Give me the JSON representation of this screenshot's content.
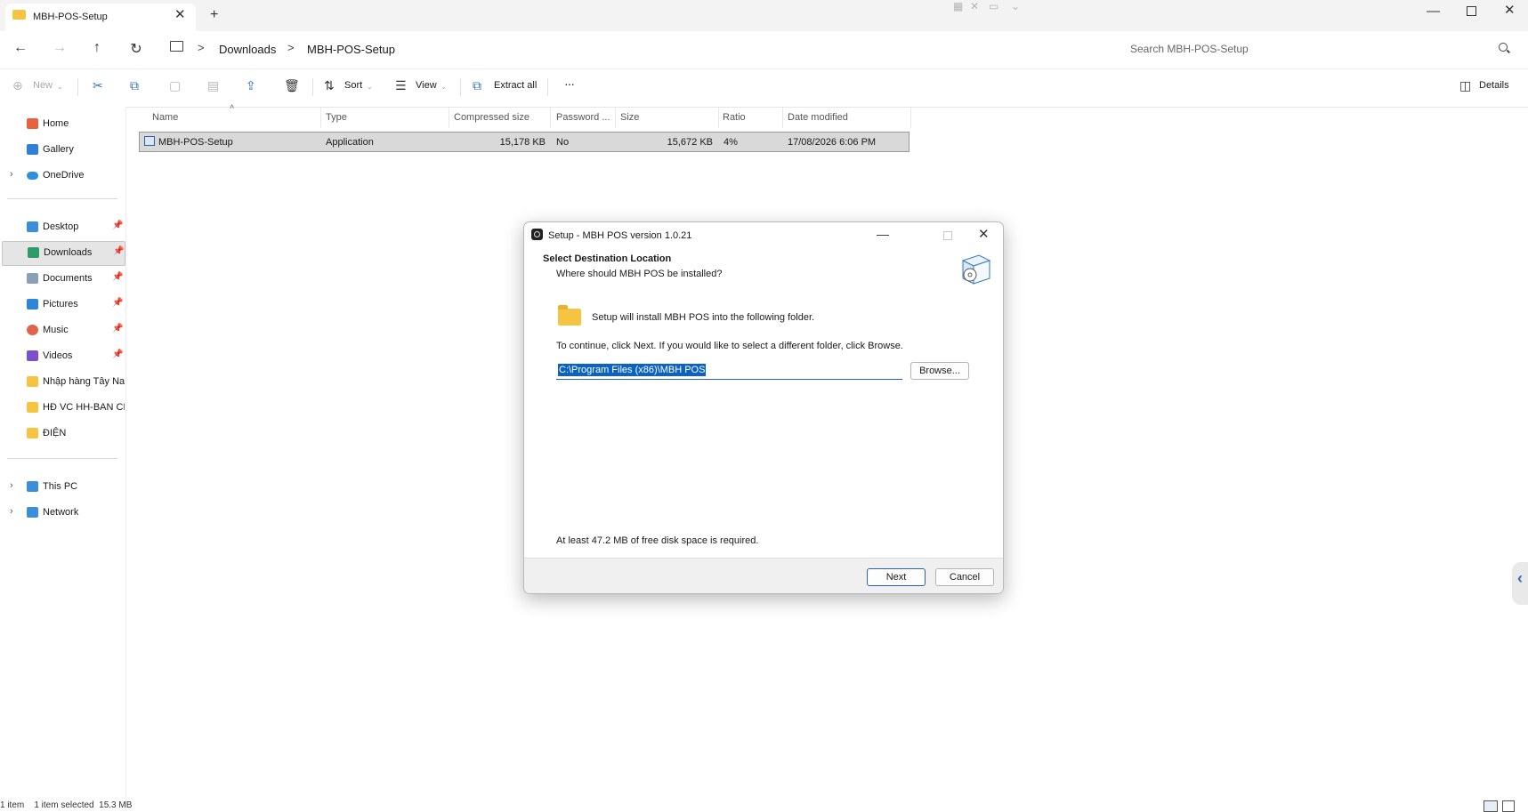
{
  "tab": {
    "title": "MBH-POS-Setup",
    "close": "✕",
    "new": "+"
  },
  "nav": {
    "back": "←",
    "forward": "→",
    "up": "↑",
    "refresh": "↻",
    "breadcrumb": [
      "Downloads",
      "MBH-POS-Setup"
    ],
    "separator": ">",
    "search_placeholder": "Search MBH-POS-Setup"
  },
  "commands": {
    "new": "New",
    "sort": "Sort",
    "view": "View",
    "extract_all": "Extract all",
    "more": "···",
    "details": "Details"
  },
  "sidebar": {
    "quick": [
      {
        "label": "Home",
        "color": "#e8623d"
      },
      {
        "label": "Gallery",
        "color": "#2f7fd6"
      },
      {
        "label": "OneDrive",
        "color": "#2f8ee0"
      }
    ],
    "pinned": [
      {
        "label": "Desktop",
        "color": "#3a8fd8"
      },
      {
        "label": "Downloads",
        "color": "#2f9a6a"
      },
      {
        "label": "Documents",
        "color": "#8aa0b8"
      },
      {
        "label": "Pictures",
        "color": "#2f86d6"
      },
      {
        "label": "Music",
        "color": "#e0644a"
      },
      {
        "label": "Videos",
        "color": "#7a52c7"
      },
      {
        "label": "Nhập hàng Tây Nar",
        "color": "#f5c542"
      },
      {
        "label": "HĐ VC HH-BAN CH",
        "color": "#f5c542"
      },
      {
        "label": "ĐIỆN",
        "color": "#f5c542"
      }
    ],
    "devices": [
      {
        "label": "This PC",
        "color": "#3a8fd8"
      },
      {
        "label": "Network",
        "color": "#3a8fd8"
      }
    ]
  },
  "table": {
    "columns": [
      "Name",
      "Type",
      "Compressed size",
      "Password ...",
      "Size",
      "Ratio",
      "Date modified"
    ],
    "rows": [
      {
        "name": "MBH-POS-Setup",
        "type": "Application",
        "compressed": "15,178 KB",
        "password": "No",
        "size": "15,672 KB",
        "ratio": "4%",
        "date": "17/08/2026 6:06 PM"
      }
    ]
  },
  "status": "1 item    1 item selected  15.3 MB",
  "dialog": {
    "title": "Setup - MBH POS version 1.0.21",
    "heading": "Select Destination Location",
    "subheading": "Where should MBH POS be installed?",
    "info": "Setup will install MBH POS into the following folder.",
    "instructions": "To continue, click Next. If you would like to select a different folder, click Browse.",
    "path": "C:\\Program Files (x86)\\MBH POS",
    "browse": "Browse...",
    "space": "At least 47.2 MB of free disk space is required.",
    "next": "Next",
    "cancel": "Cancel",
    "min": "—",
    "close": "✕"
  }
}
